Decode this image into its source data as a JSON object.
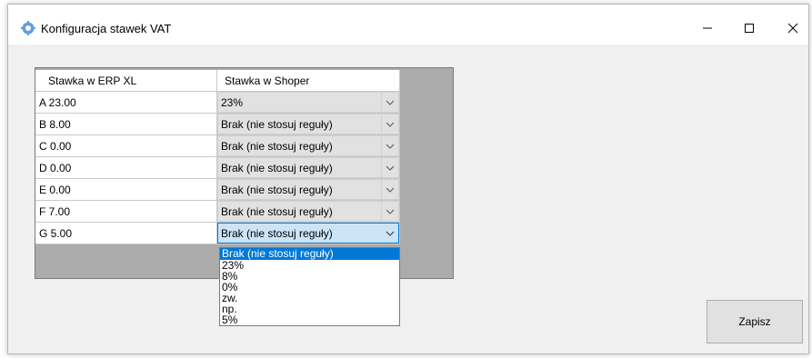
{
  "window": {
    "title": "Konfiguracja stawek VAT",
    "icon": "gear-icon",
    "controls": {
      "minimize": "minimize-icon",
      "maximize": "maximize-icon",
      "close": "close-icon"
    }
  },
  "grid": {
    "headers": [
      "Stawka w ERP XL",
      "Stawka w Shoper"
    ],
    "rows": [
      {
        "erp": "A 23.00",
        "shoper": "23%"
      },
      {
        "erp": "B 8.00",
        "shoper": "Brak (nie stosuj reguły)"
      },
      {
        "erp": "C 0.00",
        "shoper": "Brak (nie stosuj reguły)"
      },
      {
        "erp": "D 0.00",
        "shoper": "Brak (nie stosuj reguły)"
      },
      {
        "erp": "E 0.00",
        "shoper": "Brak (nie stosuj reguły)"
      },
      {
        "erp": "F 7.00",
        "shoper": "Brak (nie stosuj reguły)"
      },
      {
        "erp": "G 5.00",
        "shoper": "Brak (nie stosuj reguły)"
      }
    ]
  },
  "dropdown": {
    "options": [
      "Brak (nie stosuj reguły)",
      "23%",
      "8%",
      "0%",
      "zw.",
      "np.",
      "5%"
    ],
    "selected": "Brak (nie stosuj reguły)"
  },
  "save_label": "Zapisz",
  "colors": {
    "accent": "#0078d7",
    "grid_bg": "#ababab",
    "window_bg": "#f0f0f0"
  }
}
